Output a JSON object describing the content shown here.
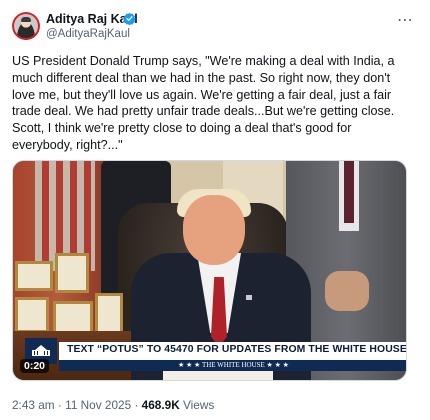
{
  "author": {
    "display_name": "Aditya Raj Kaul",
    "handle": "@AdityaRajKaul",
    "verified": true
  },
  "tweet": {
    "text": "US President Donald Trump says, \"We're making a deal with India, a much different deal than we had in the past. So right now, they don't love me, but they'll love us again. We're getting a fair deal, just a fair trade deal. We had pretty unfair trade deals...But we're getting close. Scott, I think we're pretty close to doing a deal that's good for everybody, right?...\""
  },
  "media": {
    "banner_text": "TEXT “POTUS” TO 45470 FOR UPDATES FROM THE WHITE HOUSE",
    "banner_subtext": "★ ★ ★  THE WHITE HOUSE  ★ ★ ★",
    "duration": "0:20"
  },
  "meta": {
    "time": "2:43 am",
    "separator": "·",
    "date": "11 Nov 2025",
    "views_count": "468.9K",
    "views_label": "Views"
  },
  "icons": {
    "more": "more-horizontal-icon",
    "verified": "verified-badge-icon"
  },
  "colors": {
    "verified_blue": "#1d9bf0",
    "secondary_text": "#536471",
    "banner_navy": "#0f2a55"
  }
}
